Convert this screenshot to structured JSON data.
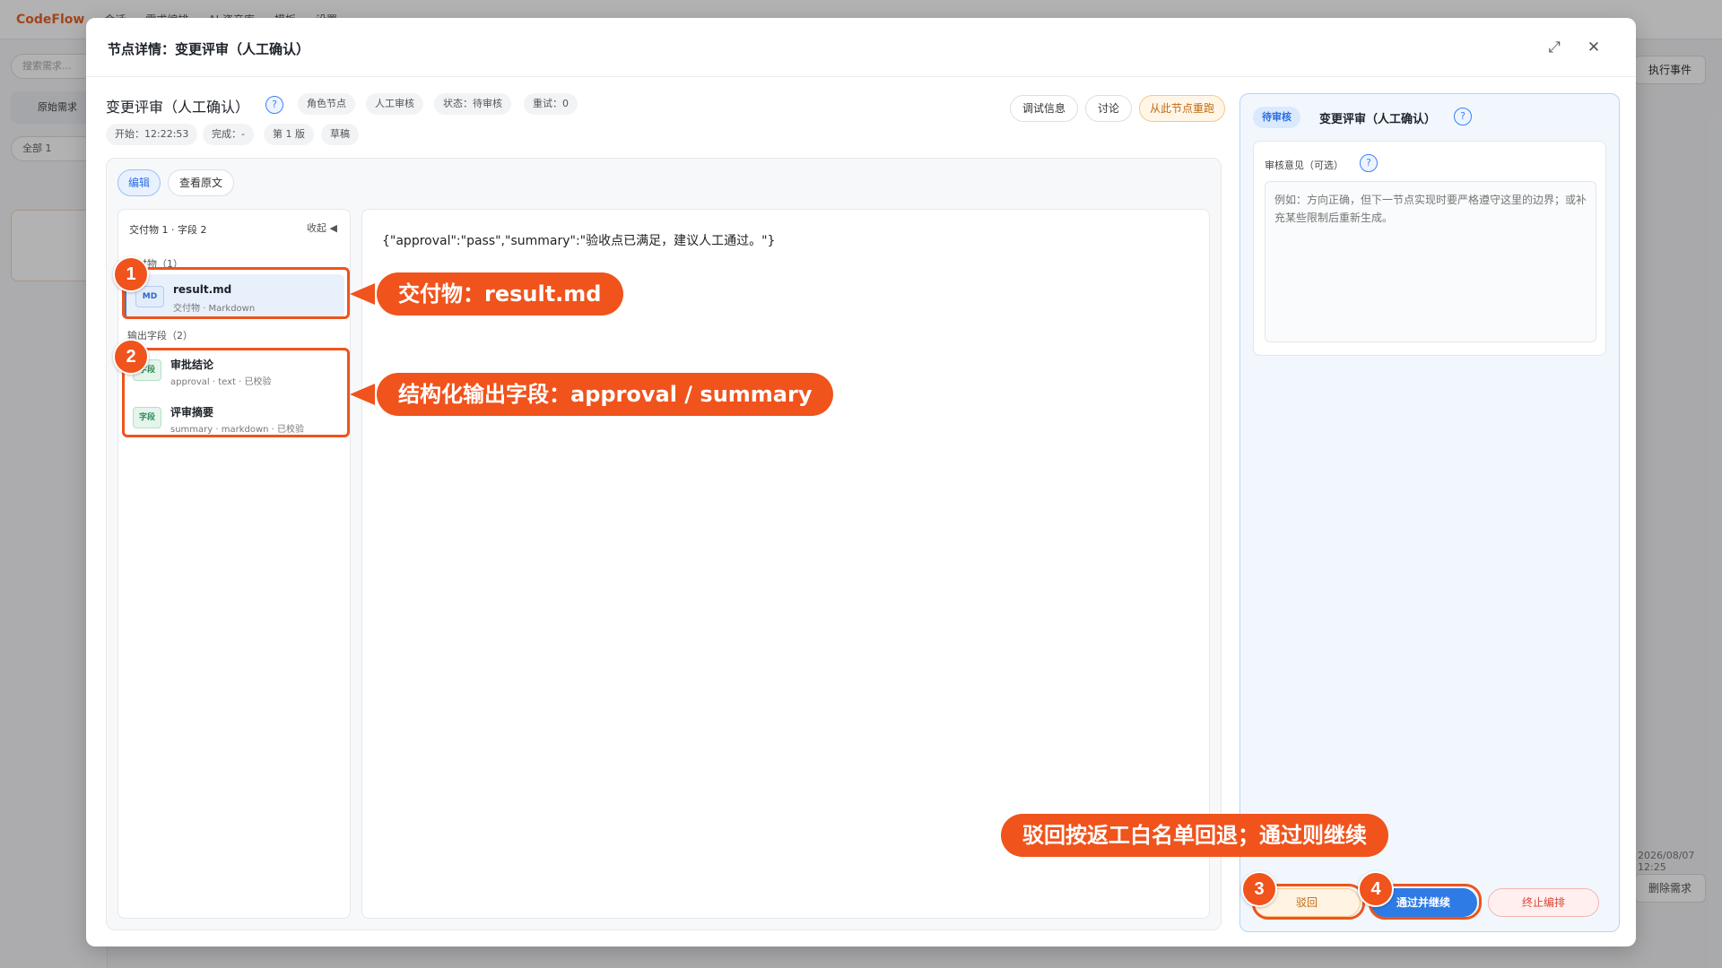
{
  "background": {
    "app_name": "CodeFlow",
    "nav": [
      "会话",
      "需求编排",
      "AI 资产库",
      "模板",
      "设置"
    ],
    "search_placeholder": "搜索需求...",
    "side_button": "原始需求",
    "filter_label": "全部 1",
    "right_button": "执行事件",
    "right_meta": "2026/08/07 12:25",
    "delete_button": "删除需求"
  },
  "modal": {
    "title": "节点详情：变更评审（人工确认）",
    "node_title": "变更评审（人工确认）",
    "chips_row1": [
      "角色节点",
      "人工审核",
      "状态：待审核",
      "重试：0"
    ],
    "chips_row2": [
      "开始：12:22:53",
      "完成：-",
      "第 1 版",
      "草稿"
    ],
    "top_buttons": {
      "debug": "调试信息",
      "discuss": "讨论",
      "rerun": "从此节点重跑"
    },
    "tabs": {
      "edit": "编辑",
      "view_raw": "查看原文"
    },
    "file_panel": {
      "header": "交付物 1 · 字段 2",
      "collapse": "收起 ◀",
      "deliverables_section": "交付物（1）",
      "fields_section": "输出字段（2）",
      "deliverables": [
        {
          "badge": "MD",
          "name": "result.md",
          "sub": "交付物 · Markdown"
        }
      ],
      "fields": [
        {
          "badge": "字段",
          "name": "审批结论",
          "sub": "approval · text · 已校验"
        },
        {
          "badge": "字段",
          "name": "评审摘要",
          "sub": "summary · markdown · 已校验"
        }
      ]
    },
    "content": "{\"approval\":\"pass\",\"summary\":\"验收点已满足，建议人工通过。\"}",
    "review": {
      "status": "待审核",
      "title": "变更评审（人工确认）",
      "comment_label": "审核意见（可选）",
      "comment_placeholder": "例如：方向正确，但下一节点实现时要严格遵守这里的边界；或补充某些限制后重新生成。",
      "buttons": {
        "reject": "驳回",
        "approve": "通过并继续",
        "stop": "终止编排"
      }
    }
  },
  "annotations": {
    "num1": "1",
    "num2": "2",
    "num3": "3",
    "num4": "4",
    "callout1": "交付物：result.md",
    "callout2": "结构化输出字段：approval / summary",
    "callout3": "驳回按返工白名单回退；通过则继续"
  },
  "colors": {
    "accent": "#f0531c",
    "primary": "#2f7be5"
  }
}
